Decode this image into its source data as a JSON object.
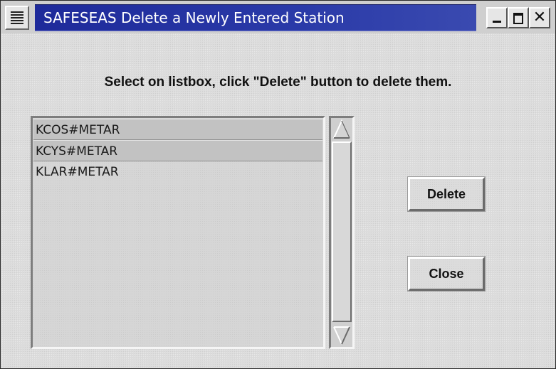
{
  "window": {
    "title": "SAFESEAS Delete a Newly Entered Station",
    "controls": {
      "minimize_icon": "minimize-icon",
      "maximize_icon": "maximize-icon",
      "close_icon": "close-icon",
      "close_glyph": "✕"
    }
  },
  "instruction": "Select on listbox,  click \"Delete\" button to delete them.",
  "listbox": {
    "items": [
      {
        "label": "KCOS#METAR",
        "selected": true
      },
      {
        "label": "KCYS#METAR",
        "selected": true
      },
      {
        "label": "KLAR#METAR",
        "selected": false
      }
    ]
  },
  "buttons": {
    "delete_label": "Delete",
    "close_label": "Close"
  },
  "colors": {
    "title_bar": "#2a3aa8",
    "background": "#dcdcdc",
    "selection": "#c2c2c2"
  }
}
